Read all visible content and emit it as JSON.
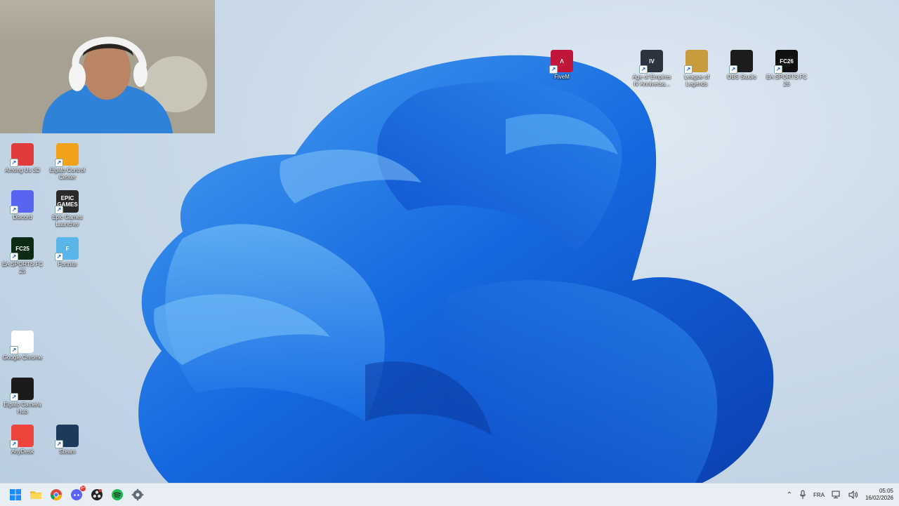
{
  "desktop": {
    "icons_left": [
      {
        "label": "Among Us 3D",
        "icon": "among-us-icon",
        "color": "#e23b3b"
      },
      {
        "label": "Elgato Control Center",
        "icon": "elgato-control-center-icon",
        "color": "#f0a21a"
      },
      {
        "label": "Discord",
        "icon": "discord-icon",
        "color": "#5865f2"
      },
      {
        "label": "Epic Games Launcher",
        "icon": "epic-games-icon",
        "color": "#2a2a2a"
      },
      {
        "label": "EA SPORTS FC 25",
        "icon": "ea-fc25-icon",
        "color": "#0c2a14"
      },
      {
        "label": "Fortnite",
        "icon": "fortnite-icon",
        "color": "#5ab6ea"
      },
      {
        "label": "Google Chrome",
        "icon": "chrome-icon",
        "color": "#ffffff"
      },
      {
        "label": "Elgato Camera Hub",
        "icon": "elgato-camera-hub-icon",
        "color": "#1b1b1b"
      },
      {
        "label": "AnyDesk",
        "icon": "anydesk-icon",
        "color": "#ef443b"
      },
      {
        "label": "Steam",
        "icon": "steam-icon",
        "color": "#1b3a5c"
      }
    ],
    "icons_top": [
      {
        "label": "FiveM",
        "icon": "fivem-icon",
        "color": "#c0163c"
      },
      {
        "label": "Age of Empires IV Anniversa...",
        "icon": "aoe4-icon",
        "color": "#2c3440"
      },
      {
        "label": "League of Legends",
        "icon": "league-icon",
        "color": "#c89b3c"
      },
      {
        "label": "OBS Studio",
        "icon": "obs-icon",
        "color": "#1d1d1d"
      },
      {
        "label": "EA SPORTS FC 26",
        "icon": "ea-fc26-icon",
        "color": "#111111"
      }
    ],
    "glyphs": {
      "epic": "EPIC\nGAMES",
      "fc25": "FC25",
      "fc26": "FC26",
      "aoe": "IV",
      "fortnite": "F",
      "fivem": "Λ"
    }
  },
  "taskbar": {
    "apps": [
      "start-icon",
      "file-explorer-icon",
      "chrome-icon",
      "discord-icon",
      "obs-icon",
      "spotify-icon",
      "settings-icon"
    ],
    "discord_badge": "9+",
    "tray": {
      "language": "FRA",
      "time": "05:05",
      "date": "16/02/2026"
    }
  }
}
